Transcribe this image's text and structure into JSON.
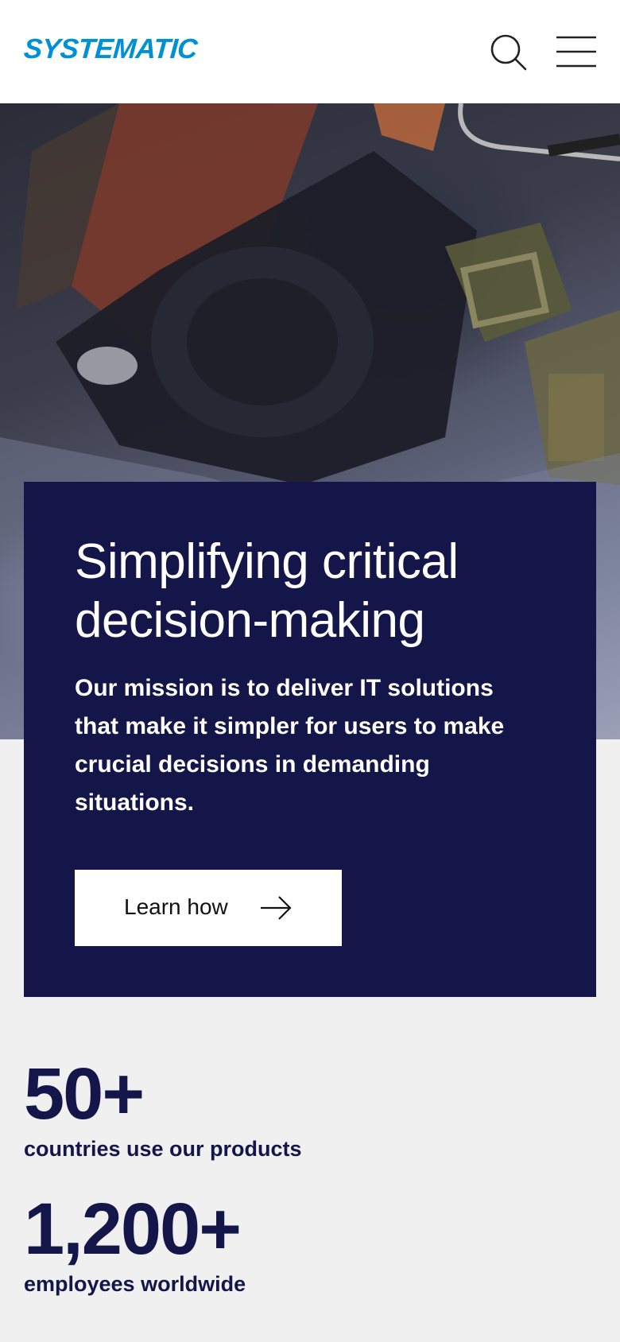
{
  "header": {
    "logo_text": "SYSTEMATIC",
    "search_icon": "search-icon",
    "menu_icon": "hamburger-menu-icon",
    "brand_color": "#0090d6"
  },
  "hero": {
    "image": "soldier-equipment-photo",
    "title": "Simplifying critical decision-making",
    "text": "Our mission is to deliver IT solutions that make it simpler for users to make crucial decisions in demanding situations.",
    "button_label": "Learn how",
    "button_icon": "arrow-right-icon",
    "card_color": "#14164a"
  },
  "stats": [
    {
      "value": "50+",
      "label": "countries use our products"
    },
    {
      "value": "1,200+",
      "label": "employees worldwide"
    }
  ]
}
